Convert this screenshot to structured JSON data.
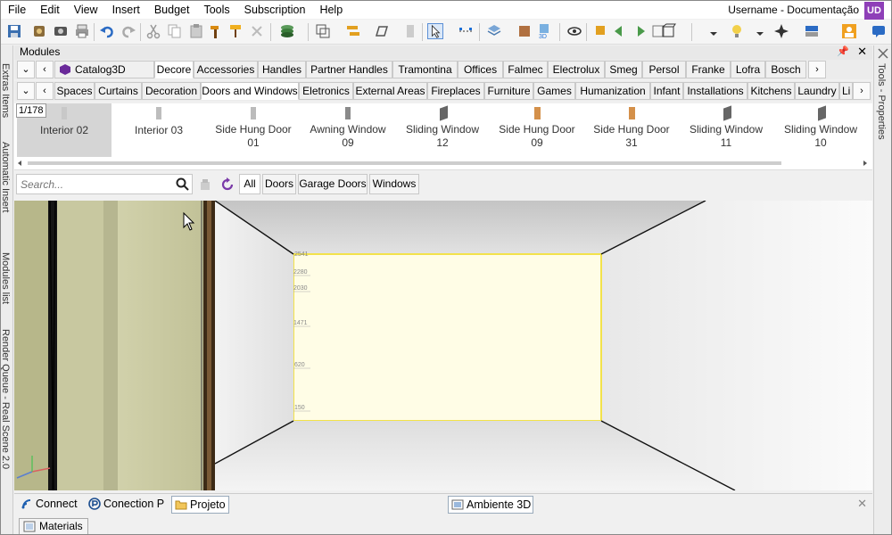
{
  "menu": [
    "File",
    "Edit",
    "View",
    "Insert",
    "Budget",
    "Tools",
    "Subscription",
    "Help"
  ],
  "user": {
    "name": "Username - Documentação",
    "avatar": "UD"
  },
  "left_panels": [
    "Extras Items",
    "Automatic Insert",
    "Modules list",
    "Render Queue - Real Scene 2.0"
  ],
  "right_panels": [
    "Tools - Properties"
  ],
  "modules": {
    "title": "Modules",
    "pin_glyph": "📌",
    "close_glyph": "✕"
  },
  "catalog_tabs": [
    "Catalog3D",
    "Decore",
    "Accessories",
    "Handles",
    "Partner Handles",
    "Tramontina",
    "Offices",
    "Falmec",
    "Electrolux",
    "Smeg",
    "Persol",
    "Franke",
    "Lofra",
    "Bosch"
  ],
  "category_tabs": [
    "Spaces",
    "Curtains",
    "Decoration",
    "Doors and Windows",
    "Eletronics",
    "External Areas",
    "Fireplaces",
    "Furniture",
    "Games",
    "Humanization",
    "Infant",
    "Installations",
    "Kitchens",
    "Laundry",
    "Li"
  ],
  "nav": {
    "down": "⌄",
    "prev": "‹",
    "next": "›"
  },
  "items_counter": "1/178",
  "items": [
    {
      "name": "Interior 02",
      "line2": "",
      "icon": "door-icon",
      "color": "#c8c8c8"
    },
    {
      "name": "Interior 03",
      "line2": "",
      "icon": "door-icon",
      "color": "#bdbdbd"
    },
    {
      "name": "Side Hung Door",
      "line2": "01",
      "icon": "door-icon",
      "color": "#bbbbbb"
    },
    {
      "name": "Awning Window",
      "line2": "09",
      "icon": "window-icon",
      "color": "#8a8a8a"
    },
    {
      "name": "Sliding Window",
      "line2": "12",
      "icon": "window-icon",
      "color": "#666666"
    },
    {
      "name": "Side Hung Door",
      "line2": "09",
      "icon": "door-icon",
      "color": "#d4904a"
    },
    {
      "name": "Side Hung Door",
      "line2": "31",
      "icon": "door-icon",
      "color": "#d4904a"
    },
    {
      "name": "Sliding Window",
      "line2": "11",
      "icon": "window-icon",
      "color": "#666666"
    },
    {
      "name": "Sliding Window",
      "line2": "10",
      "icon": "window-icon",
      "color": "#666666"
    }
  ],
  "search": {
    "placeholder": "Search..."
  },
  "filters": [
    "All",
    "Doors",
    "Garage Doors",
    "Windows"
  ],
  "wall_marks": [
    "2541",
    "2280",
    "2030",
    "1471",
    "620",
    "150"
  ],
  "bottom_tabs": [
    "Connect",
    "Conection P",
    "Projeto"
  ],
  "viewport_tab": "Ambiente 3D",
  "materials_tab": "Materials",
  "colors": {
    "accent_purple": "#8e3fb8",
    "wall_highlight": "#fffde6",
    "wall_border": "#f2e24a"
  }
}
